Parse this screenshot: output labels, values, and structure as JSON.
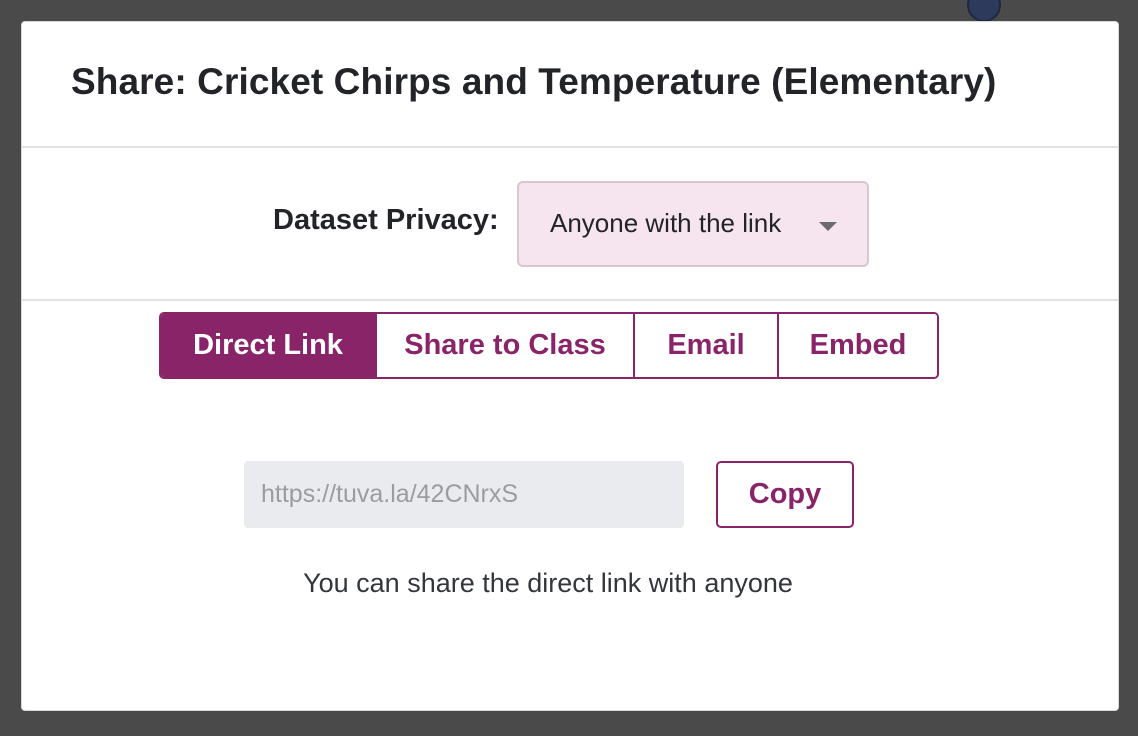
{
  "modal": {
    "title": "Share: Cricket Chirps and Temperature (Elementary)"
  },
  "privacy": {
    "label": "Dataset Privacy:",
    "selected": "Anyone with the link",
    "caret_icon": "chevron-down-icon"
  },
  "tabs": [
    {
      "label": "Direct Link",
      "active": true
    },
    {
      "label": "Share to Class",
      "active": false
    },
    {
      "label": "Email",
      "active": false
    },
    {
      "label": "Embed",
      "active": false
    }
  ],
  "direct_link": {
    "url": "https://tuva.la/42CNrxS",
    "copy_label": "Copy",
    "help": "You can share the direct link with anyone"
  },
  "colors": {
    "accent": "#8a2469",
    "backdrop": "#4a4a4a",
    "select_bg": "#f6e4ee",
    "field_bg": "#e9ebef"
  }
}
